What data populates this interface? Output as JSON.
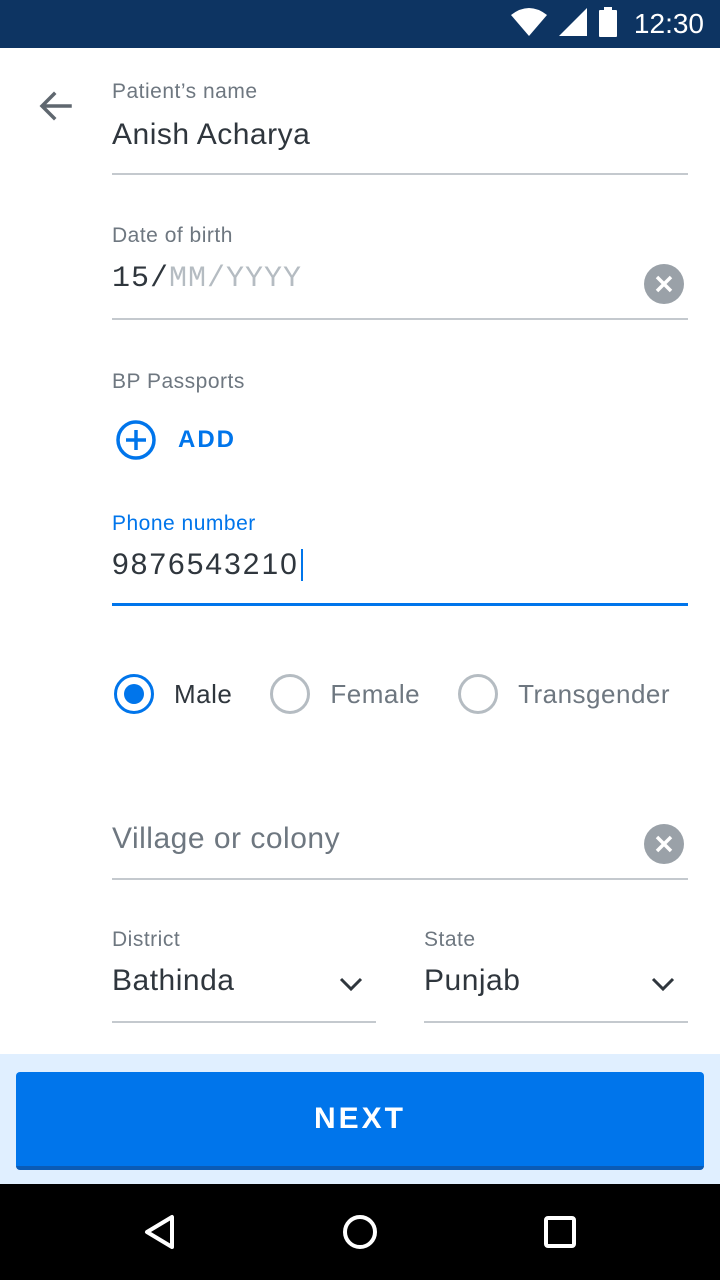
{
  "status_bar": {
    "time": "12:30",
    "icons": [
      "wifi-icon",
      "signal-icon",
      "battery-icon"
    ]
  },
  "form": {
    "name": {
      "label": "Patient’s name",
      "value": "Anish Acharya"
    },
    "dob": {
      "label": "Date of birth",
      "entered": "15/",
      "placeholder_rest": "MM/YYYY"
    },
    "bp_passports": {
      "label": "BP Passports",
      "add_label": "ADD"
    },
    "phone": {
      "label": "Phone number",
      "value": "9876543210"
    },
    "gender": {
      "options": [
        "Male",
        "Female",
        "Transgender"
      ],
      "selected": "Male"
    },
    "village": {
      "placeholder": "Village or colony"
    },
    "district": {
      "label": "District",
      "value": "Bathinda"
    },
    "state": {
      "label": "State",
      "value": "Punjab"
    }
  },
  "next_button": {
    "label": "NEXT"
  },
  "colors": {
    "primary": "#0075eb",
    "status_bar": "#0d3462",
    "text": "#2f363d",
    "muted": "#6e7780",
    "bottom_area": "#e0efff"
  }
}
